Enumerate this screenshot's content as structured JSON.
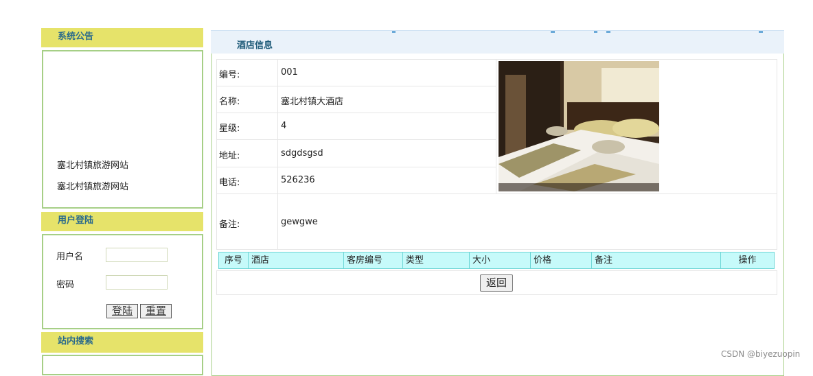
{
  "sidebar": {
    "notice": {
      "title": "系统公告",
      "items": [
        "塞北村镇旅游网站",
        "塞北村镇旅游网站"
      ]
    },
    "login": {
      "title": "用户登陆",
      "username_label": "用户名",
      "password_label": "密码",
      "username_value": "",
      "password_value": "",
      "login_button": "登陆",
      "reset_button": "重置"
    },
    "search": {
      "title": "站内搜索"
    }
  },
  "main": {
    "title": "酒店信息",
    "fields": [
      {
        "label": "编号:",
        "value": "001"
      },
      {
        "label": "名称:",
        "value": "塞北村镇大酒店"
      },
      {
        "label": "星级:",
        "value": "4"
      },
      {
        "label": "地址:",
        "value": "sdgdsgsd"
      },
      {
        "label": "电话:",
        "value": "526236"
      },
      {
        "label": "备注:",
        "value": "gewgwe"
      }
    ],
    "room_table_headers": [
      "序号",
      "酒店",
      "客房编号",
      "类型",
      "大小",
      "价格",
      "备注",
      "操作"
    ],
    "back_button": "返回"
  },
  "watermark": "CSDN @biyezuopin",
  "colors": {
    "sidebar_header_bg": "#e6e36a",
    "panel_border": "#a6cf86",
    "table_header_bg": "#c6fafa",
    "main_header_bg": "#eaf2fa"
  }
}
